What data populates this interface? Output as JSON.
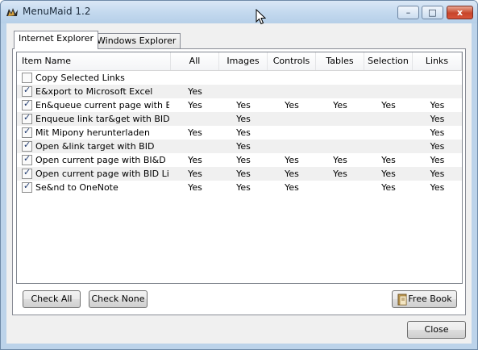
{
  "window": {
    "title": "MenuMaid 1.2"
  },
  "title_buttons": {
    "minimize_glyph": "–",
    "maximize_glyph": "□",
    "close_glyph": "x"
  },
  "tabs": [
    {
      "label": "Internet Explorer",
      "active": true
    },
    {
      "label": "Windows Explorer",
      "active": false
    }
  ],
  "columns": [
    "Item Name",
    "All",
    "Images",
    "Controls",
    "Tables",
    "Selection",
    "Links"
  ],
  "rows": [
    {
      "name": "Copy Selected Links",
      "checked": false,
      "all": "",
      "images": "",
      "controls": "",
      "tables": "",
      "selection": "",
      "links": ""
    },
    {
      "name": "E&xport to Microsoft Excel",
      "checked": true,
      "all": "Yes",
      "images": "",
      "controls": "",
      "tables": "",
      "selection": "",
      "links": ""
    },
    {
      "name": "En&queue current page with BID",
      "checked": true,
      "all": "Yes",
      "images": "Yes",
      "controls": "Yes",
      "tables": "Yes",
      "selection": "Yes",
      "links": "Yes"
    },
    {
      "name": "Enqueue link tar&get with BID",
      "checked": true,
      "all": "",
      "images": "Yes",
      "controls": "",
      "tables": "",
      "selection": "",
      "links": "Yes"
    },
    {
      "name": "Mit Mipony herunterladen",
      "checked": true,
      "all": "Yes",
      "images": "Yes",
      "controls": "",
      "tables": "",
      "selection": "",
      "links": "Yes"
    },
    {
      "name": "Open &link target with BID",
      "checked": true,
      "all": "",
      "images": "Yes",
      "controls": "",
      "tables": "",
      "selection": "",
      "links": "Yes"
    },
    {
      "name": "Open current page with BI&D",
      "checked": true,
      "all": "Yes",
      "images": "Yes",
      "controls": "Yes",
      "tables": "Yes",
      "selection": "Yes",
      "links": "Yes"
    },
    {
      "name": "Open current page with BID Link...",
      "checked": true,
      "all": "Yes",
      "images": "Yes",
      "controls": "Yes",
      "tables": "Yes",
      "selection": "Yes",
      "links": "Yes"
    },
    {
      "name": "Se&nd to OneNote",
      "checked": true,
      "all": "Yes",
      "images": "Yes",
      "controls": "Yes",
      "tables": "",
      "selection": "Yes",
      "links": "Yes"
    }
  ],
  "buttons": {
    "check_all": "Check All",
    "check_none": "Check None",
    "free_book": "Free Book",
    "close": "Close"
  },
  "icons": {
    "app": "menumaid-icon",
    "book": "book-icon",
    "checkmark_glyph": "✓"
  },
  "colors": {
    "title_bar": "#c2d8ee",
    "close_button": "#c7452b",
    "row_shade": "#f0f0f0",
    "list_border": "#828790"
  }
}
